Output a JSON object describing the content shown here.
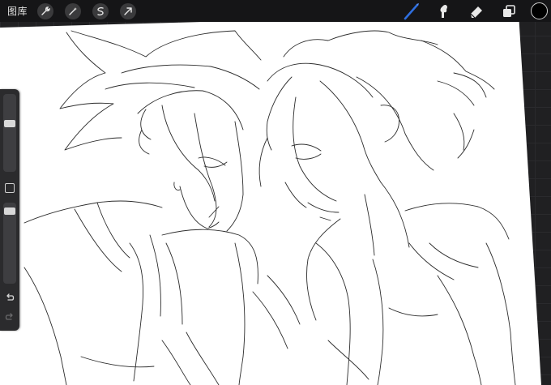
{
  "toolbar": {
    "gallery_label": "图库",
    "left_tools": [
      "wrench-icon",
      "magic-wand-icon",
      "selection-icon",
      "transform-arrow-icon"
    ],
    "right_tools": [
      "brush-icon",
      "smudge-icon",
      "eraser-icon",
      "layers-icon"
    ],
    "active_tool": "brush-icon",
    "active_color": "#000000",
    "accent": "#2f6fe0"
  },
  "sidebar": {
    "brush_size_level": 0.62,
    "opacity_level": 0.9,
    "undo_icon": "undo-icon",
    "redo_icon": "redo-icon"
  },
  "canvas": {
    "content": "sketch-artwork",
    "paper_color": "#ffffff",
    "line_color": "#2a2a2a"
  }
}
